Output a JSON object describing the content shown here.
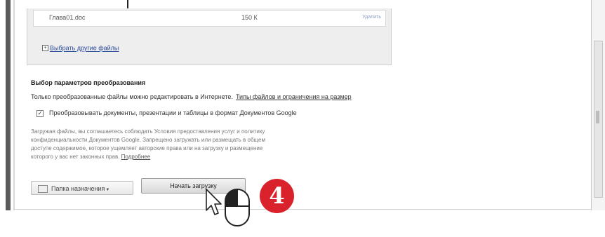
{
  "file_list": {
    "files": [
      {
        "name": "Глава01.doc",
        "size": "150 К",
        "remove_label": "Удалить"
      }
    ],
    "add_files_label": "Выбрать другие файлы"
  },
  "conversion": {
    "section_title": "Выбор параметров преобразования",
    "hint_text": "Только преобразованные файлы можно редактировать в Интернете.",
    "hint_link": "Типы файлов и ограничения на размер",
    "convert_checkbox_label": "Преобразовывать документы, презентации и таблицы в формат Документов Google",
    "convert_checked": true
  },
  "terms": {
    "lines": [
      "Загружая файлы, вы соглашаетесь соблюдать Условия предоставления услуг и политику",
      "конфиденциальности Документов Google. Запрещено загружать или размещать в общем",
      "доступе содержимое, которое ущемляет авторские права или на загрузку и размещение",
      "которого у вас нет законных прав."
    ],
    "more_link": "Подробнее"
  },
  "actions": {
    "folder_button_label": "Папка назначения",
    "start_button_label": "Начать загрузку"
  },
  "annotation": {
    "step_number": "4",
    "badge_color": "#d9222c"
  },
  "icons": [
    "plus-icon",
    "checkbox-checked-icon",
    "folder-icon",
    "dropdown-caret-icon",
    "mouse-pointer-icon",
    "mouse-left-click-icon"
  ]
}
